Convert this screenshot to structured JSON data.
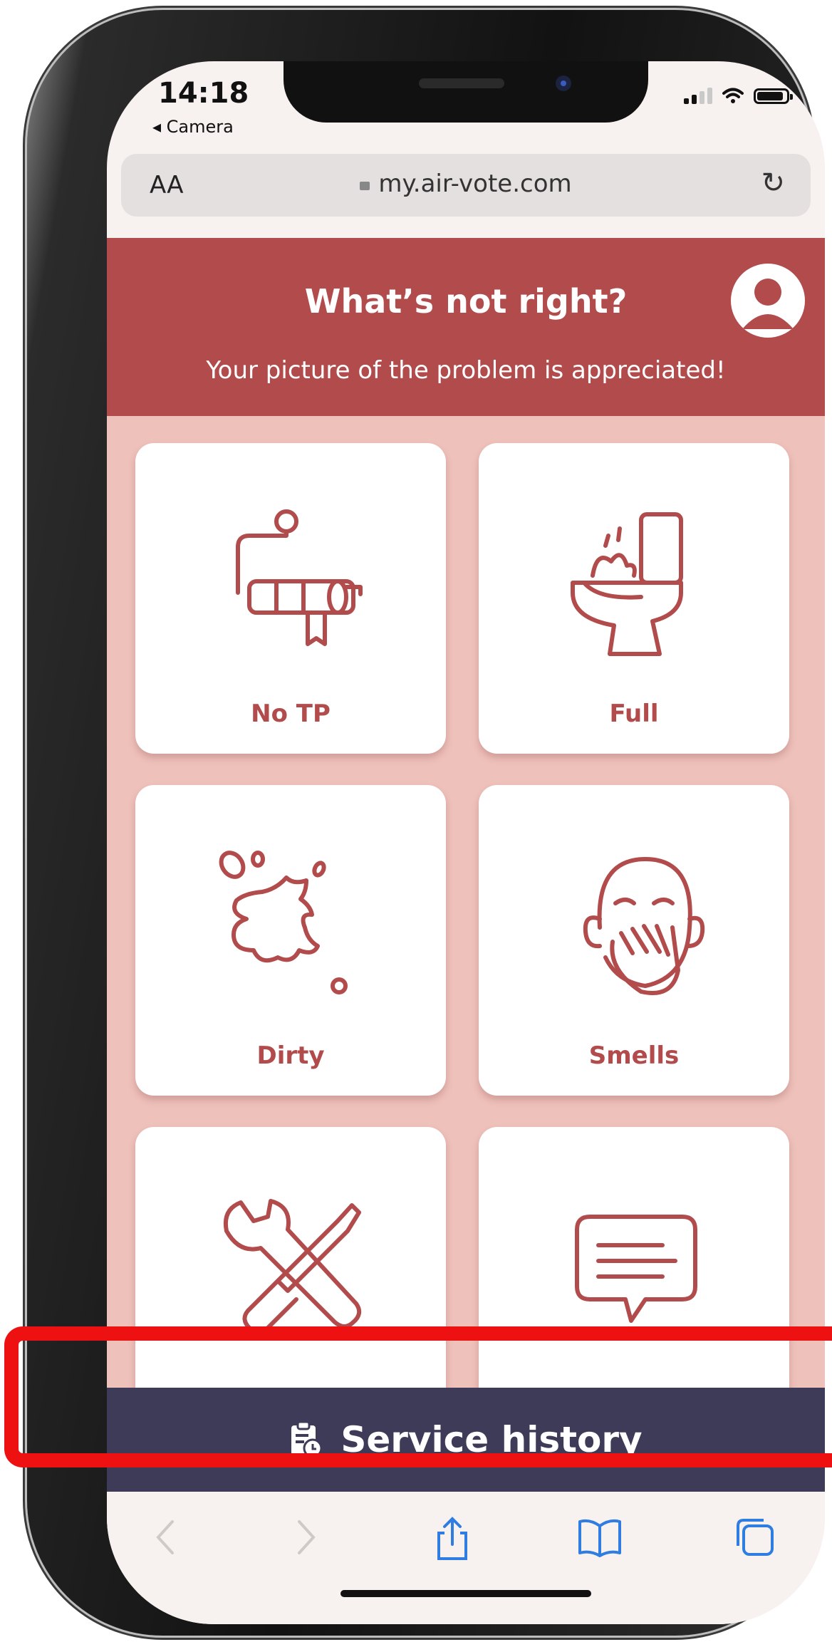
{
  "status_bar": {
    "time": "14:18",
    "back_app": "◂ Camera"
  },
  "browser": {
    "text_size_label": "AA",
    "url": "my.air-vote.com",
    "reload_icon": "reload-icon"
  },
  "header": {
    "title": "What’s not right?",
    "subtitle": "Your picture of the problem is appreciated!",
    "avatar_icon": "user-avatar-icon"
  },
  "tiles": [
    {
      "label": "No TP",
      "icon": "toilet-paper-icon"
    },
    {
      "label": "Full",
      "icon": "overflowing-toilet-icon"
    },
    {
      "label": "Dirty",
      "icon": "splash-stain-icon"
    },
    {
      "label": "Smells",
      "icon": "covering-nose-icon"
    },
    {
      "label": "",
      "icon": "wrench-screwdriver-icon"
    },
    {
      "label": "",
      "icon": "speech-bubble-icon"
    }
  ],
  "service_bar": {
    "label": "Service history",
    "icon": "clipboard-clock-icon"
  },
  "colors": {
    "header": "#b24b4b",
    "grid_background": "#efc1bb",
    "service_bar": "#3d3b58",
    "highlight": "#ee1111"
  }
}
